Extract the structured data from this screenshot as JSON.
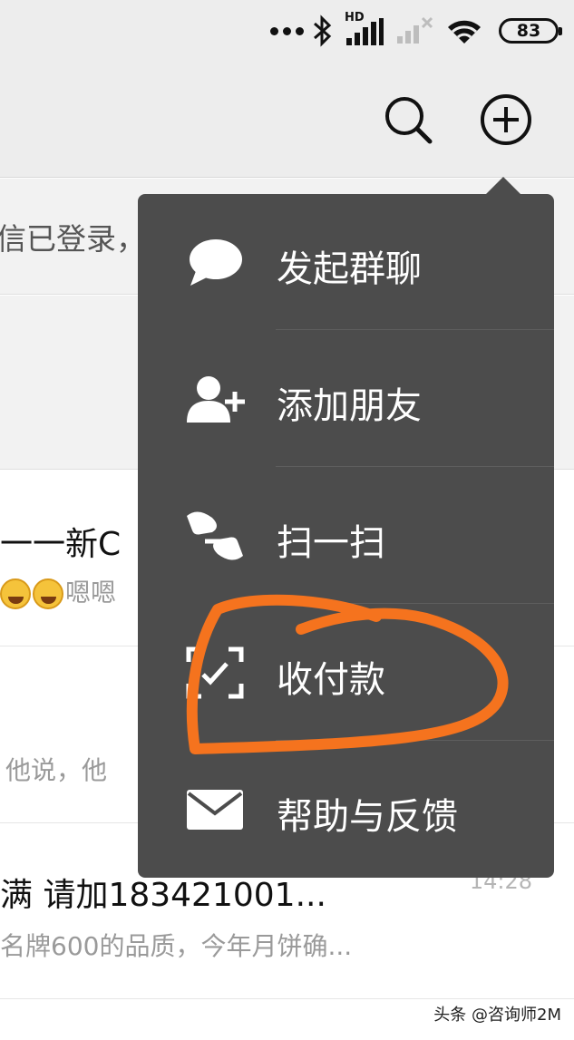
{
  "status_bar": {
    "network_label": "HD",
    "battery_level": "83",
    "icons": [
      "more-dots-icon",
      "bluetooth-icon",
      "signal-hd-icon",
      "signal-no-service-icon",
      "wifi-icon",
      "battery-icon"
    ]
  },
  "header": {
    "icons": [
      "search-icon",
      "add-circle-icon"
    ]
  },
  "chat_list": {
    "notice_text": "信已登录，",
    "chats": [
      {
        "title": "一一新C",
        "preview": "嗯嗯",
        "time": ""
      },
      {
        "title": "",
        "preview": "他说，他",
        "time": ""
      },
      {
        "title": "满 请加183421001...",
        "preview": "名牌600的品质，今年月饼确...",
        "time": "14:28"
      }
    ]
  },
  "menu": {
    "items": [
      {
        "label": "发起群聊",
        "icon": "chat-bubble-icon"
      },
      {
        "label": "添加朋友",
        "icon": "add-friend-icon"
      },
      {
        "label": "扫一扫",
        "icon": "scan-icon"
      },
      {
        "label": "收付款",
        "icon": "payment-scan-icon"
      },
      {
        "label": "帮助与反馈",
        "icon": "envelope-icon"
      }
    ]
  },
  "annotation": {
    "color": "#f5731e",
    "highlight_target": "收付款"
  },
  "watermark": {
    "text": "头条 @咨询师2M"
  },
  "colors": {
    "menu_bg": "#4c4c4c",
    "header_bg": "#ededed",
    "annotation": "#f5731e"
  }
}
